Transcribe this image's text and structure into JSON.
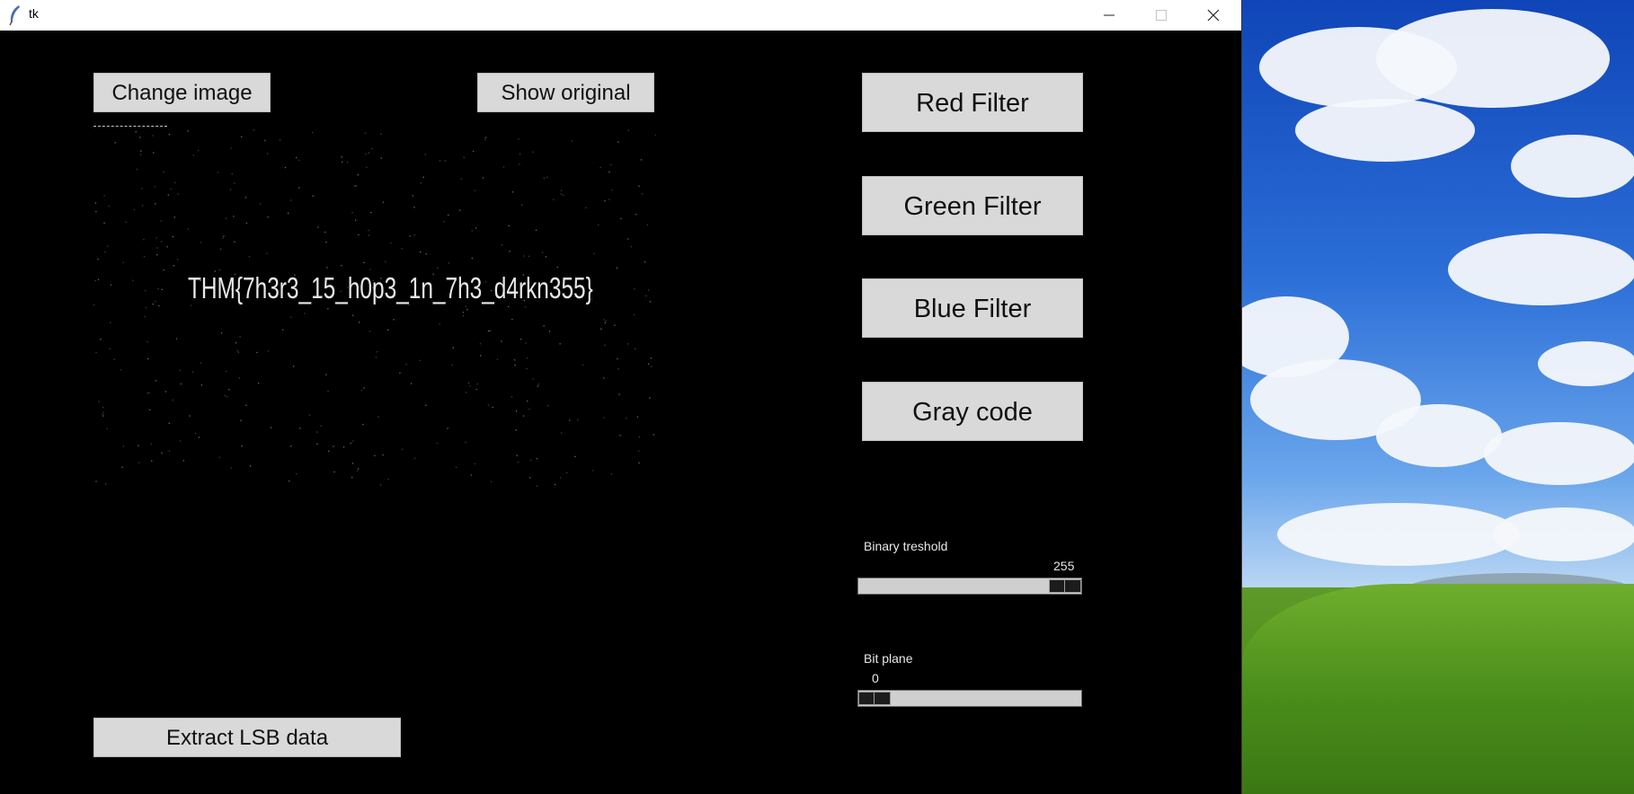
{
  "window": {
    "title": "tk"
  },
  "toolbar": {
    "change_image": "Change image",
    "show_original": "Show original",
    "extract_lsb": "Extract LSB data"
  },
  "image": {
    "hidden_text": "THM{7h3r3_15_h0p3_1n_7h3_d4rkn355}"
  },
  "filters": {
    "red": "Red Filter",
    "green": "Green Filter",
    "blue": "Blue Filter",
    "gray_code": "Gray code"
  },
  "sliders": {
    "binary_threshold": {
      "label": "Binary treshold",
      "value": "255",
      "fraction": 1.0
    },
    "bit_plane": {
      "label": "Bit plane",
      "value": "0",
      "fraction": 0.0
    }
  },
  "colors": {
    "window_bg": "#000000",
    "button_bg": "#d9d9d9"
  }
}
